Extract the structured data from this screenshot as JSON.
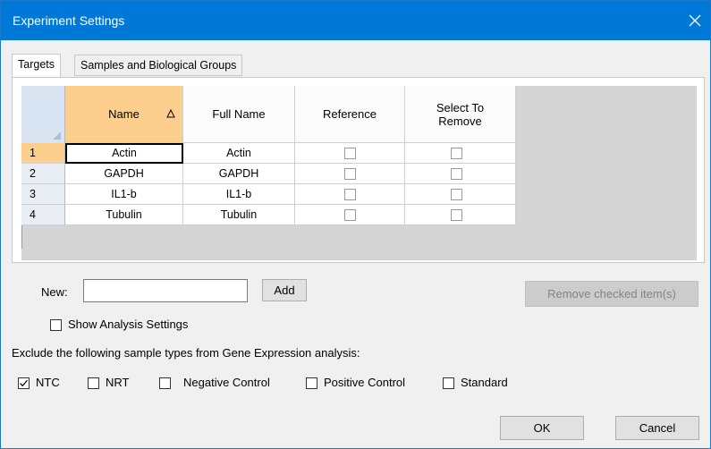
{
  "window": {
    "title": "Experiment Settings"
  },
  "tabs": [
    {
      "label": "Targets",
      "active": true
    },
    {
      "label": "Samples and Biological Groups",
      "active": false
    }
  ],
  "grid": {
    "columns": [
      {
        "label": "Name",
        "sorted": true
      },
      {
        "label": "Full Name",
        "sorted": false
      },
      {
        "label": "Reference",
        "sorted": false
      },
      {
        "label": "Select To Remove",
        "sorted": false
      }
    ],
    "rows": [
      {
        "num": "1",
        "name": "Actin",
        "full_name": "Actin",
        "reference": false,
        "remove": false
      },
      {
        "num": "2",
        "name": "GAPDH",
        "full_name": "GAPDH",
        "reference": false,
        "remove": false
      },
      {
        "num": "3",
        "name": "IL1-b",
        "full_name": "IL1-b",
        "reference": false,
        "remove": false
      },
      {
        "num": "4",
        "name": "Tubulin",
        "full_name": "Tubulin",
        "reference": false,
        "remove": false
      }
    ]
  },
  "new_target": {
    "label": "New:",
    "value": "",
    "add_label": "Add"
  },
  "remove_checked_label": "Remove checked item(s)",
  "show_analysis": {
    "label": "Show Analysis Settings",
    "checked": false
  },
  "exclude": {
    "heading": "Exclude the following sample types from Gene Expression analysis:",
    "options": [
      {
        "label": "NTC",
        "checked": true
      },
      {
        "label": "NRT",
        "checked": false
      },
      {
        "label": "Negative Control",
        "checked": false
      },
      {
        "label": "Positive Control",
        "checked": false
      },
      {
        "label": "Standard",
        "checked": false
      }
    ]
  },
  "footer": {
    "ok_label": "OK",
    "cancel_label": "Cancel"
  },
  "colors": {
    "titlebar": "#0078d7",
    "sorted_header": "#fdcf8e",
    "grid_background": "#d4d4d4"
  },
  "icons": {
    "close": "close-icon",
    "sort": "sort-ascending-icon",
    "check": "checkmark-icon"
  }
}
